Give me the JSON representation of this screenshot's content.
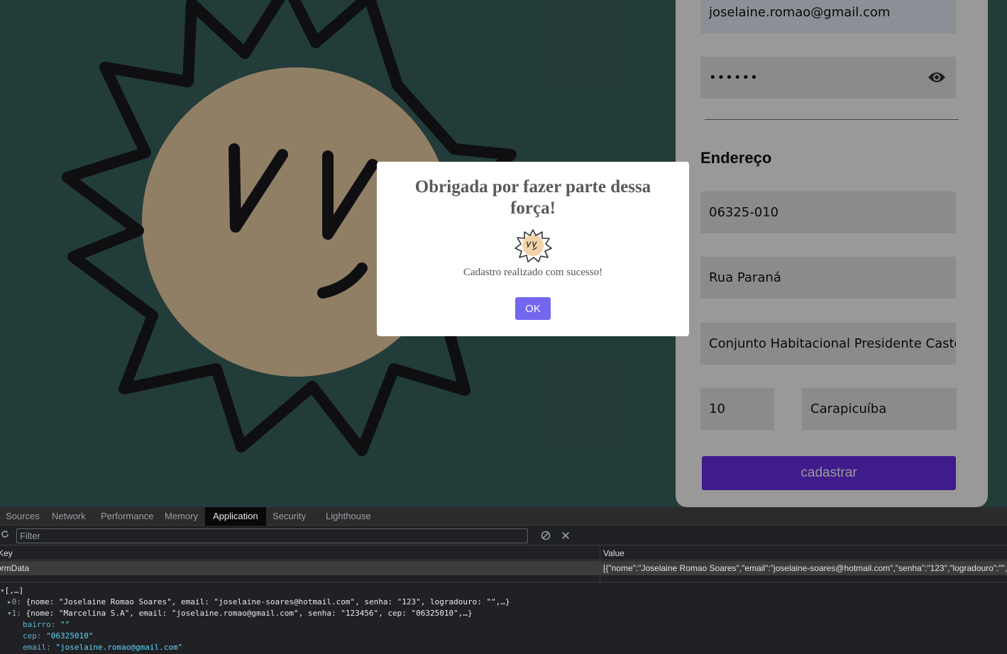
{
  "form": {
    "email_value": "joselaine.romao@gmail.com",
    "password_value": "••••••",
    "section_title": "Endereço",
    "cep_value": "06325-010",
    "logradouro_value": "Rua Paraná",
    "bairro_value": "Conjunto Habitacional Presidente Castelo",
    "numero_value": "10",
    "cidade_value": "Carapicuíba",
    "submit_label": "cadastrar"
  },
  "modal": {
    "title": "Obrigada por fazer parte dessa força!",
    "message": "Cadastro realizado com sucesso!",
    "ok_label": "OK"
  },
  "devtools": {
    "tabs": [
      "Sources",
      "Network",
      "Performance",
      "Memory",
      "Application",
      "Security",
      "Lighthouse"
    ],
    "active_tab": "Application",
    "filter_placeholder": "Filter",
    "columns": {
      "key": "Key",
      "value": "Value"
    },
    "row": {
      "key": "ormData",
      "value": "[{\"nome\":\"Joselaine Romao Soares\",\"email\":\"joselaine-soares@hotmail.com\",\"senha\":\"123\",\"logradouro\":\"\",\"b"
    },
    "tree": {
      "root": "[,…]",
      "item0_index": "0",
      "item0_summary": "{nome: \"Joselaine Romao Soares\", email: \"joselaine-soares@hotmail.com\", senha: \"123\", logradouro: \"\",…}",
      "item1_index": "1",
      "item1_summary": "{nome: \"Marcelina S.A\", email: \"joselaine.romao@gmail.com\", senha: \"123456\", cep: \"06325010\",…}",
      "props": [
        {
          "name": "bairro",
          "value": "\"\""
        },
        {
          "name": "cep",
          "value": "\"06325010\""
        },
        {
          "name": "email",
          "value": "\"joselaine.romao@gmail.com\""
        }
      ]
    }
  },
  "colors": {
    "page_background": "#3a6461",
    "sun_face": "#f2d4a8",
    "submit_button": "#6a2ee8",
    "ok_button": "#7367f0",
    "devtools_background": "#202124"
  }
}
